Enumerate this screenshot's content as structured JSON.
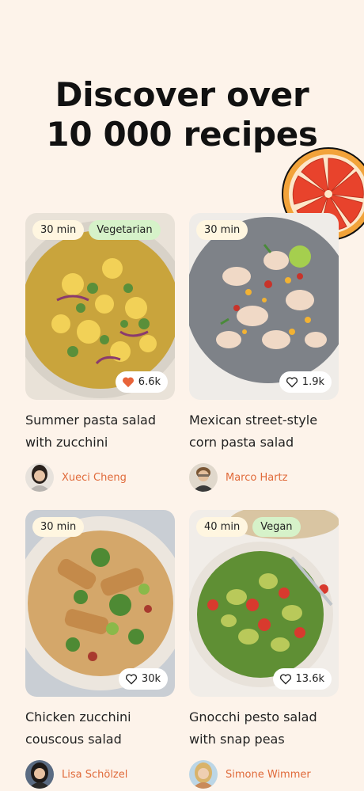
{
  "headline": {
    "line1": "Discover over",
    "line2": "10 000 recipes"
  },
  "recipes": [
    {
      "time": "30 min",
      "diet": "Vegetarian",
      "likes": "6.6k",
      "liked": true,
      "title_line1": "Summer pasta salad",
      "title_line2": "with zucchini",
      "author": "Xueci Cheng"
    },
    {
      "time": "30 min",
      "diet": "",
      "likes": "1.9k",
      "liked": false,
      "title_line1": "Mexican street-style",
      "title_line2": "corn pasta salad",
      "author": "Marco Hartz"
    },
    {
      "time": "30 min",
      "diet": "",
      "likes": "30k",
      "liked": false,
      "title_line1": "Chicken zucchini",
      "title_line2": "couscous salad",
      "author": "Lisa Schölzel"
    },
    {
      "time": "40 min",
      "diet": "Vegan",
      "likes": "13.6k",
      "liked": false,
      "title_line1": "Gnocchi pesto salad",
      "title_line2": "with snap peas",
      "author": "Simone Wimmer"
    }
  ],
  "colors": {
    "background": "#fdf3ea",
    "author": "#e06a3a",
    "liked_heart": "#e8643a",
    "vegan_tag": "#d6f2c9"
  }
}
